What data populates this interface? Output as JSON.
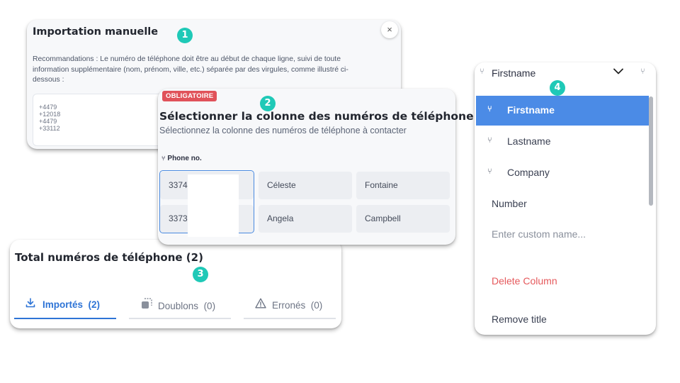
{
  "markers": [
    "1",
    "2",
    "3",
    "4"
  ],
  "manual_import": {
    "title": "Importation manuelle",
    "close_icon": "×",
    "recommendation_lines": [
      "Recommandations : Le numéro de téléphone doit être au début de chaque ligne, suivi de toute",
      "information supplémentaire (nom, prénom, ville, etc.) séparée par des virgules, comme illustré ci-",
      "dessous :"
    ],
    "sample_lines": [
      "+4479",
      "+12018",
      "+4479",
      "+33112"
    ]
  },
  "column_select": {
    "badge": "OBLIGATOIRE",
    "title": "Sélectionner la colonne des numéros de téléphone",
    "subtitle": "Sélectionnez la colonne des numéros de téléphone à contacter",
    "column_label": "Phone no.",
    "rows": [
      [
        "3374",
        "Céleste",
        "Fontaine"
      ],
      [
        "3373",
        "Angela",
        "Campbell"
      ]
    ]
  },
  "totals": {
    "title": "Total numéros de téléphone (2)",
    "tabs": [
      {
        "label": "Importés",
        "count": "(2)",
        "icon": "download-icon",
        "active": true
      },
      {
        "label": "Doublons",
        "count": "(0)",
        "icon": "duplicate-icon",
        "active": false
      },
      {
        "label": "Erronés",
        "count": "(0)",
        "icon": "warning-icon",
        "active": false
      }
    ]
  },
  "column_dropdown": {
    "selected": "Firstname",
    "options": [
      "Firstname",
      "Lastname",
      "Company"
    ],
    "number_label": "Number",
    "custom_placeholder": "Enter custom name...",
    "delete_label": "Delete Column",
    "remove_label": "Remove title"
  },
  "colors": {
    "accent": "#2e74d6",
    "selected_option": "#4b8be6",
    "badge_teal": "#1fc9b7",
    "required_red": "#e0525a",
    "delete_red": "#e5595c"
  }
}
